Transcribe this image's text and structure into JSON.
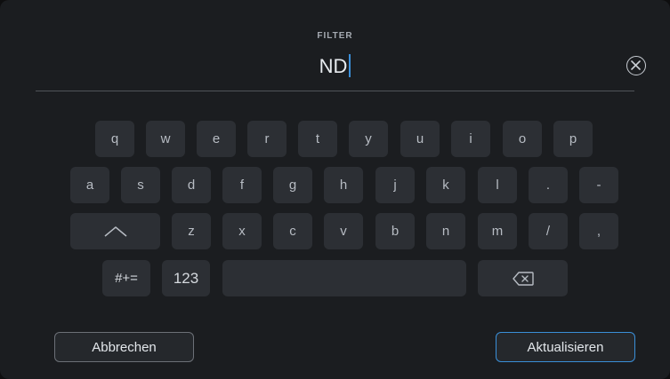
{
  "header": {
    "label": "FILTER"
  },
  "input": {
    "value": "ND",
    "clear_icon": "close-circle-icon"
  },
  "keyboard": {
    "row1": [
      "q",
      "w",
      "e",
      "r",
      "t",
      "y",
      "u",
      "i",
      "o",
      "p"
    ],
    "row2": [
      "a",
      "s",
      "d",
      "f",
      "g",
      "h",
      "j",
      "k",
      "l",
      ".",
      "-"
    ],
    "row3": [
      "z",
      "x",
      "c",
      "v",
      "b",
      "n",
      "m",
      "/",
      ","
    ],
    "shift_icon": "shift-caret-icon",
    "symbols_label": "#+=",
    "numbers_label": "123",
    "backspace_icon": "backspace-icon"
  },
  "actions": {
    "cancel_label": "Abbrechen",
    "update_label": "Aktualisieren"
  },
  "colors": {
    "accent": "#3a8fd8",
    "panel": "#1b1d20",
    "key": "#2c2f34"
  }
}
